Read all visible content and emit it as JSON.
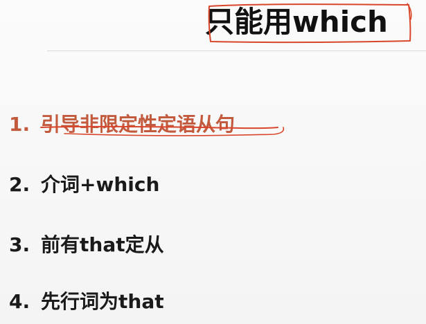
{
  "title": "只能用which",
  "items": [
    {
      "number": "1.",
      "text": "引导非限定性定语从句"
    },
    {
      "number": "2.",
      "text": "介词+which"
    },
    {
      "number": "3.",
      "text": "前有that定从"
    },
    {
      "number": "4.",
      "text": "先行词为that"
    }
  ],
  "colors": {
    "accent": "#c25a3e",
    "annotation": "#d9452b",
    "text": "#1a1a1a"
  }
}
